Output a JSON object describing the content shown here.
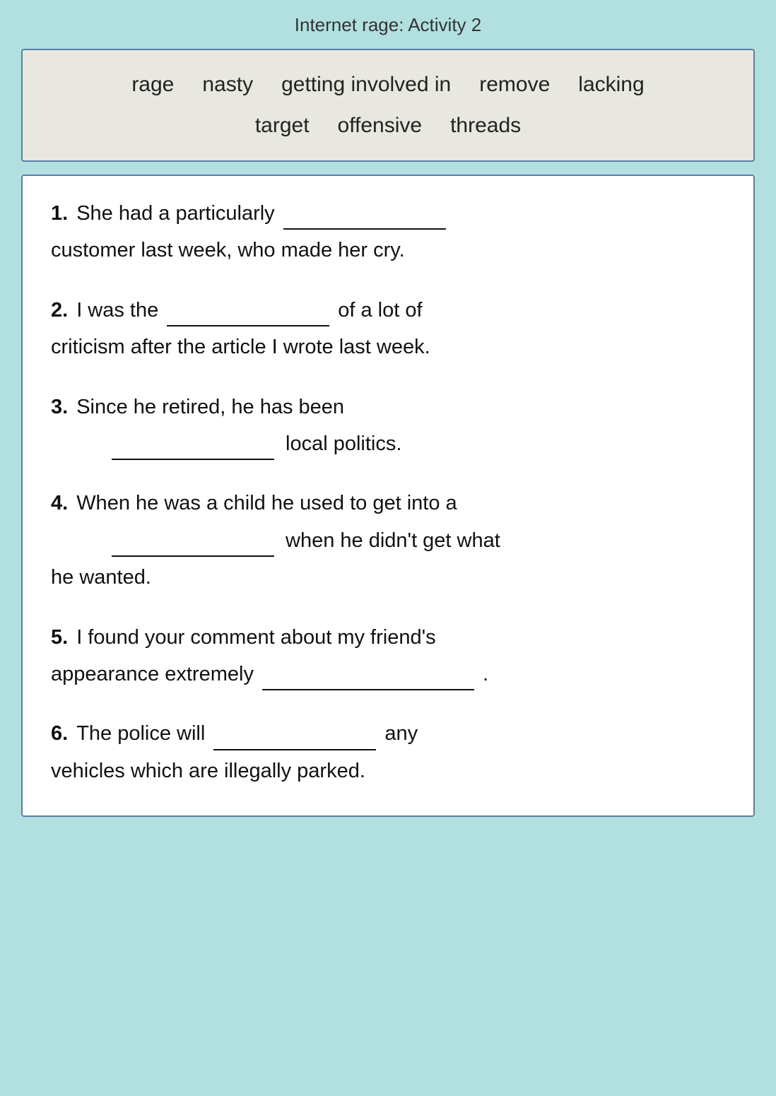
{
  "page": {
    "title": "Internet rage: Activity 2"
  },
  "word_bank": {
    "row1": [
      "rage",
      "nasty",
      "getting involved in",
      "remove",
      "lacking"
    ],
    "row2": [
      "target",
      "offensive",
      "threads"
    ]
  },
  "exercises": [
    {
      "number": "1.",
      "parts": [
        {
          "text": "She had a particularly",
          "blank": true,
          "blank_size": "medium"
        },
        {
          "text": "customer last week, who made her cry.",
          "indent": false
        }
      ]
    },
    {
      "number": "2.",
      "parts": [
        {
          "text": "I was the",
          "blank": true,
          "blank_size": "medium",
          "inline_after": "of a lot of"
        },
        {
          "text": "criticism after the article I wrote last week.",
          "indent": false
        }
      ]
    },
    {
      "number": "3.",
      "parts": [
        {
          "text": "Since he retired, he has been"
        },
        {
          "blank": true,
          "blank_size": "medium",
          "indent": true,
          "inline_before": "",
          "inline_after": "local politics."
        }
      ]
    },
    {
      "number": "4.",
      "parts": [
        {
          "text": "When he was a child he used to get into a"
        },
        {
          "blank": true,
          "blank_size": "medium",
          "indent": true,
          "inline_after": "when he didn’t get what"
        },
        {
          "text": "he wanted.",
          "indent": false
        }
      ]
    },
    {
      "number": "5.",
      "parts": [
        {
          "text": "I found your comment about my friend’s"
        },
        {
          "text": "appearance extremely",
          "blank": true,
          "blank_size": "long",
          "period": true
        }
      ]
    },
    {
      "number": "6.",
      "parts": [
        {
          "text": "The police will",
          "blank": true,
          "blank_size": "medium",
          "inline_after": "any"
        },
        {
          "text": "vehicles which are illegally parked.",
          "indent": false
        }
      ]
    }
  ]
}
